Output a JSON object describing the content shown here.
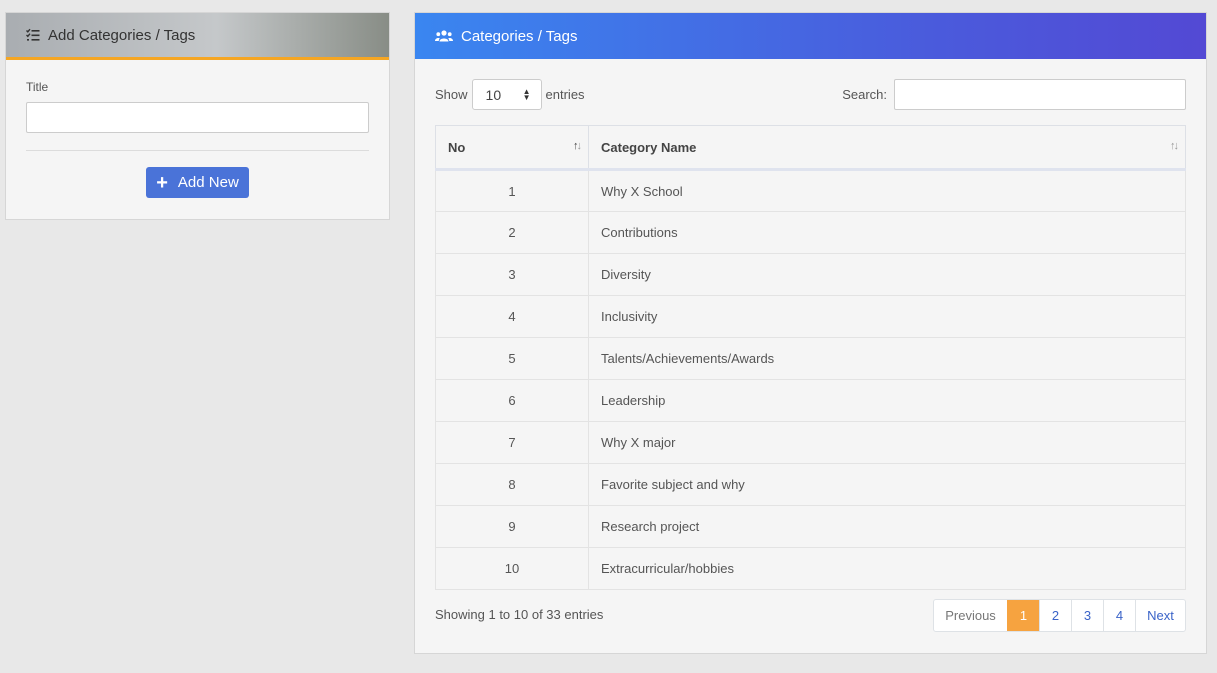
{
  "add_panel": {
    "title": "Add Categories / Tags",
    "title_label": "Title",
    "title_value": "",
    "add_button": "Add New"
  },
  "list_panel": {
    "title": "Categories / Tags",
    "show_label": "Show",
    "entries_value": "10",
    "entries_label": "entries",
    "search_label": "Search:",
    "search_value": "",
    "columns": [
      "No",
      "Category Name"
    ],
    "rows": [
      {
        "no": "1",
        "name": "Why X School"
      },
      {
        "no": "2",
        "name": "Contributions"
      },
      {
        "no": "3",
        "name": "Diversity"
      },
      {
        "no": "4",
        "name": "Inclusivity"
      },
      {
        "no": "5",
        "name": "Talents/Achievements/Awards"
      },
      {
        "no": "6",
        "name": "Leadership"
      },
      {
        "no": "7",
        "name": "Why X major"
      },
      {
        "no": "8",
        "name": "Favorite subject and why"
      },
      {
        "no": "9",
        "name": "Research project"
      },
      {
        "no": "10",
        "name": "Extracurricular/hobbies"
      }
    ],
    "info": "Showing 1 to 10 of 33 entries",
    "pagination": {
      "previous": "Previous",
      "pages": [
        "1",
        "2",
        "3",
        "4"
      ],
      "current": "1",
      "next": "Next"
    }
  },
  "icons": {
    "add_panel_header": "list-check-icon",
    "list_panel_header": "users-icon",
    "add_button": "plus-icon",
    "select_caret": "sort-caret-icon",
    "column_sort": "sort-arrows-icon"
  },
  "colors": {
    "accent_orange": "#f6a340",
    "button_blue": "#4a73d8",
    "header_gradient_start": "#3a86f0",
    "header_gradient_end": "#5349d4"
  }
}
